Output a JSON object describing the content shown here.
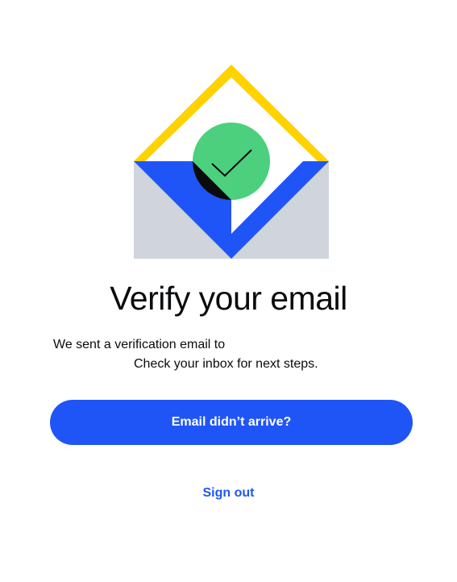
{
  "colors": {
    "accent": "#1f55f7",
    "check_green": "#4cd07d",
    "flap_yellow": "#ffd200",
    "envelope_gray": "#cfd4dd",
    "text": "#0a0b0d"
  },
  "illustration": {
    "icon": "email-verified-envelope-icon"
  },
  "title": "Verify your email",
  "message": {
    "line1": "We sent a verification email to",
    "line2": "Check your inbox for next steps."
  },
  "actions": {
    "resend_label": "Email didn’t arrive?",
    "sign_out_label": "Sign out"
  }
}
